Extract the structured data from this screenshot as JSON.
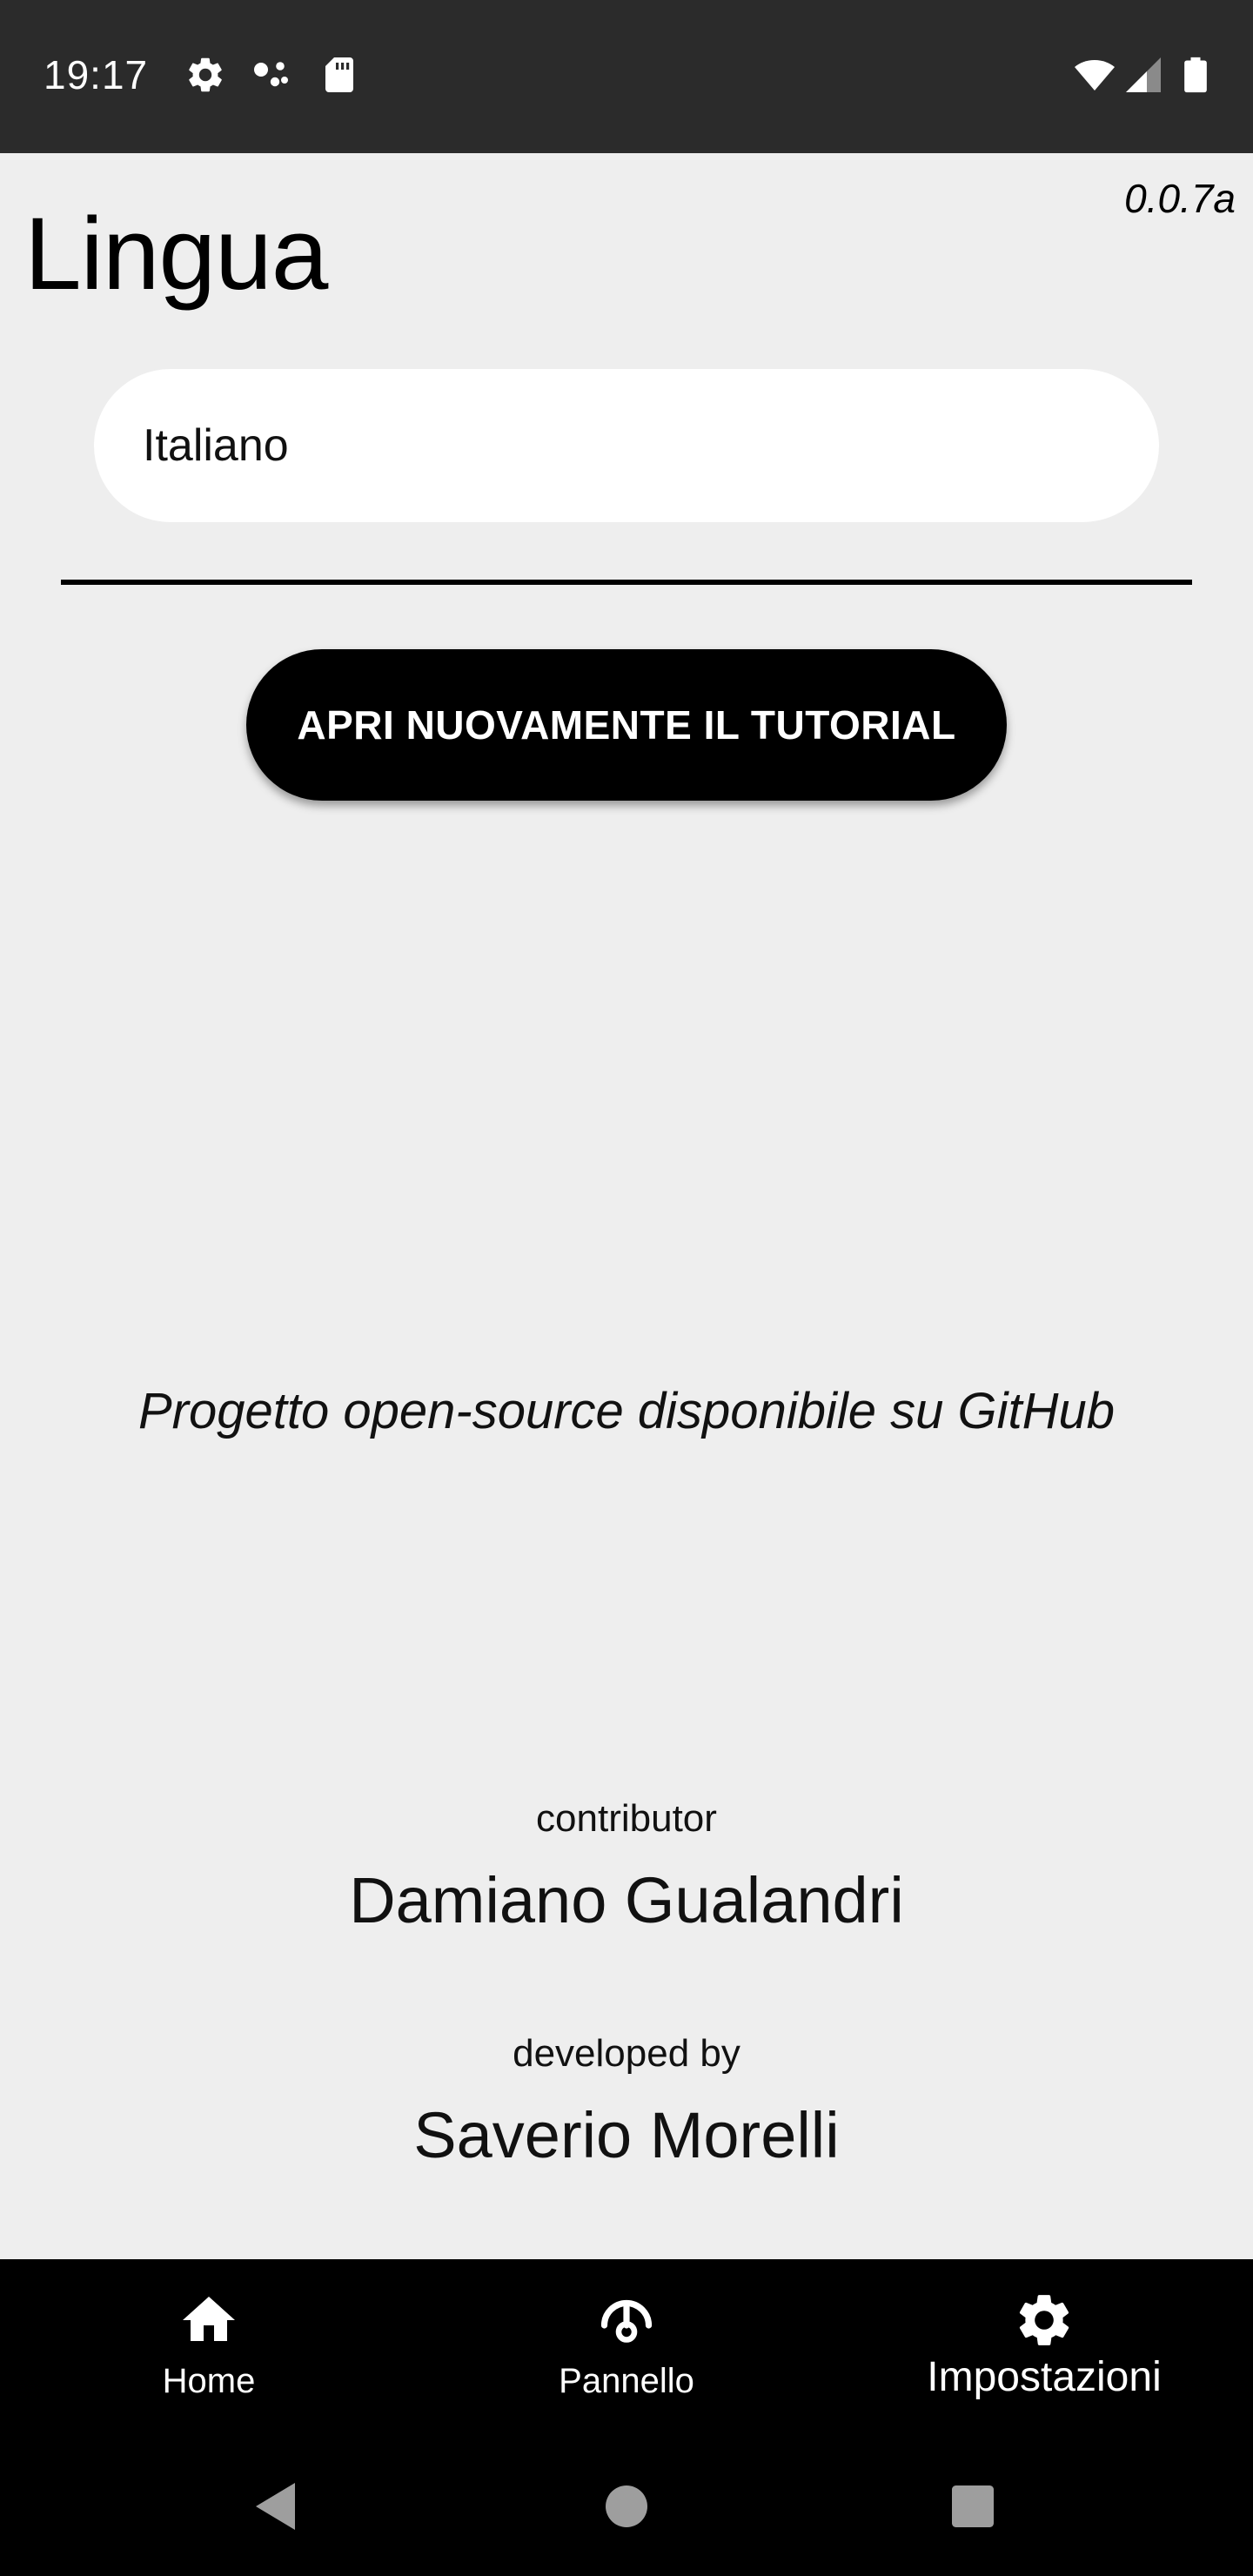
{
  "status_bar": {
    "time": "19:17",
    "left_icons": [
      "gear-icon",
      "assistant-dots-icon",
      "sd-card-icon"
    ],
    "right_icons": [
      "wifi-icon",
      "signal-icon",
      "battery-icon"
    ]
  },
  "header": {
    "version": "0.0.7a",
    "title": "Lingua"
  },
  "language_select": {
    "value": "Italiano"
  },
  "tutorial_button": {
    "label": "APRI NUOVAMENTE IL TUTORIAL"
  },
  "project_note": "Progetto open-source disponibile su GitHub",
  "credits": {
    "contributor_label": "contributor",
    "contributor_name": "Damiano Gualandri",
    "developer_label": "developed by",
    "developer_name": "Saverio Morelli"
  },
  "bottom_nav": {
    "items": [
      {
        "label": "Home",
        "icon": "home-icon"
      },
      {
        "label": "Pannello",
        "icon": "gauge-icon"
      },
      {
        "label": "Impostazioni",
        "icon": "gear-icon",
        "active": true
      }
    ]
  },
  "system_nav": {
    "buttons": [
      "back-icon",
      "home-circle-icon",
      "recents-icon"
    ]
  },
  "colors": {
    "background": "#eeeeee",
    "status_bar": "#2b2b2b",
    "accent": "#000000",
    "field": "#ffffff"
  }
}
